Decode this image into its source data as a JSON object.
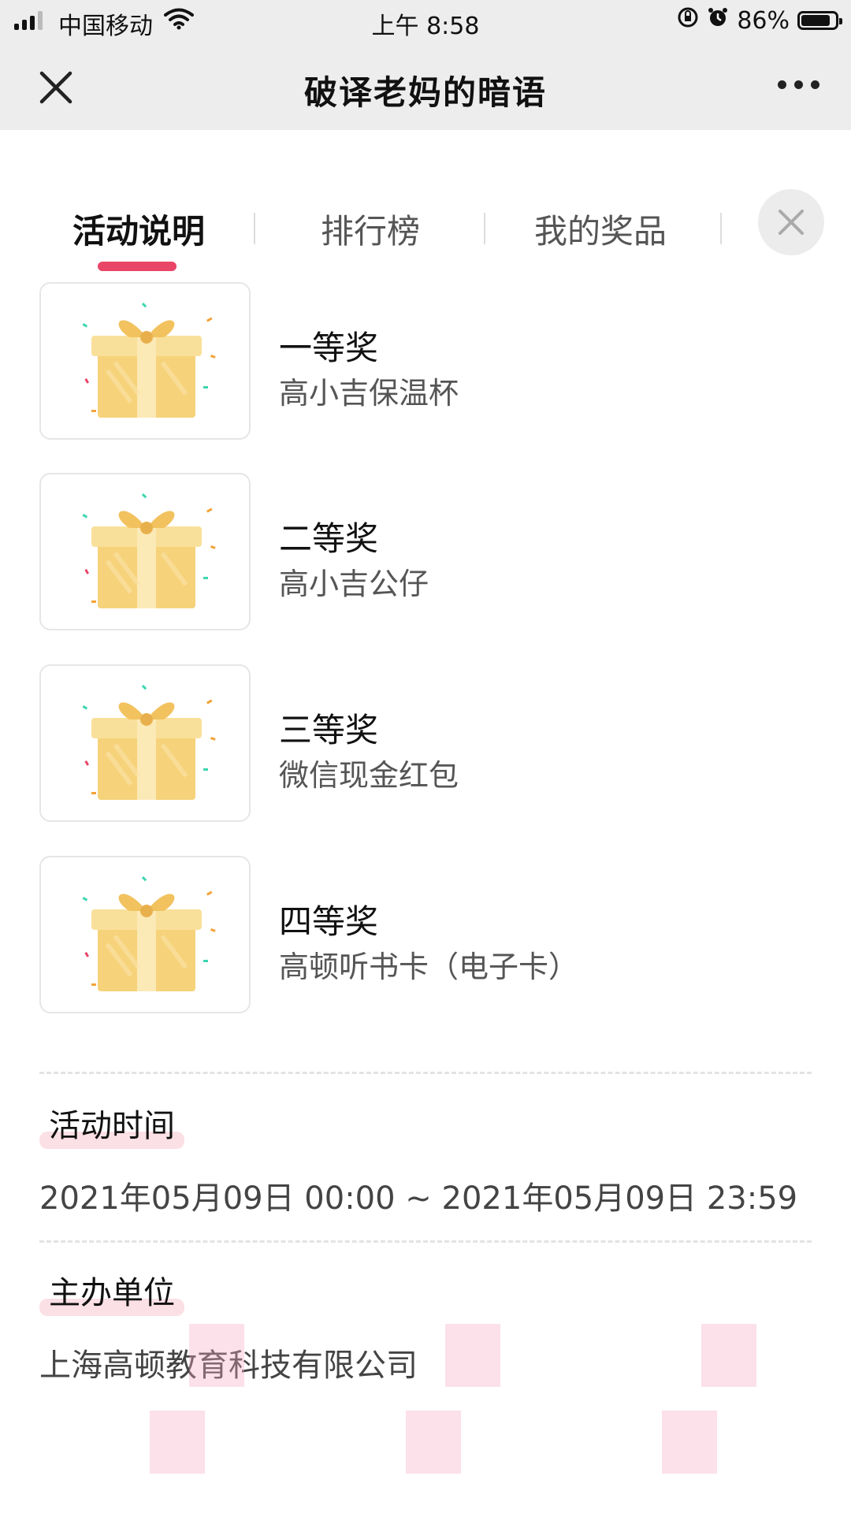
{
  "status_bar": {
    "carrier": "中国移动",
    "time": "上午 8:58",
    "battery_percent": "86%",
    "battery_level": 0.86,
    "signal_bars": 3
  },
  "nav": {
    "title": "破译老妈的暗语"
  },
  "tabs": [
    {
      "label": "活动说明",
      "active": true
    },
    {
      "label": "排行榜",
      "active": false
    },
    {
      "label": "我的奖品",
      "active": false
    }
  ],
  "prizes": [
    {
      "tier": "一等奖",
      "name": "高小吉保温杯",
      "icon": "gift-box-icon"
    },
    {
      "tier": "二等奖",
      "name": "高小吉公仔",
      "icon": "gift-box-icon"
    },
    {
      "tier": "三等奖",
      "name": "微信现金红包",
      "icon": "gift-box-icon"
    },
    {
      "tier": "四等奖",
      "name": "高顿听书卡（电子卡）",
      "icon": "gift-box-icon"
    }
  ],
  "activity_time": {
    "title": "活动时间",
    "value": "2021年05月09日 00:00 ~ 2021年05月09日 23:59"
  },
  "organizer": {
    "title": "主办单位",
    "value": "上海高顿教育科技有限公司"
  },
  "colors": {
    "accent": "#e94567",
    "highlight": "#fbe0e6",
    "topband": "#ededed"
  }
}
